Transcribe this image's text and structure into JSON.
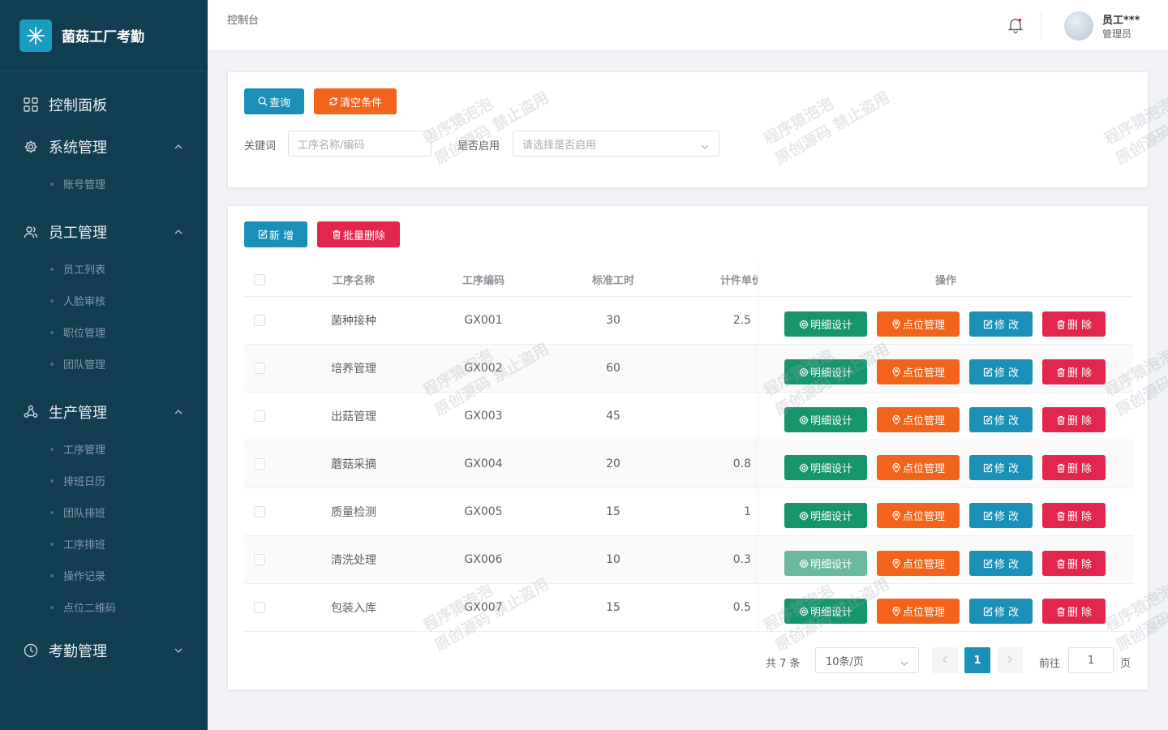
{
  "app": {
    "title": "菌菇工厂考勤"
  },
  "sidebar": {
    "groups": [
      {
        "label": "控制面板",
        "icon": "dashboard-icon",
        "items": []
      },
      {
        "label": "系统管理",
        "icon": "gear-icon",
        "items": [
          "账号管理"
        ]
      },
      {
        "label": "员工管理",
        "icon": "users-icon",
        "items": [
          "员工列表",
          "人脸审核",
          "职位管理",
          "团队管理"
        ]
      },
      {
        "label": "生产管理",
        "icon": "flow-icon",
        "items": [
          "工序管理",
          "排班日历",
          "团队排班",
          "工序排班",
          "操作记录",
          "点位二维码"
        ]
      },
      {
        "label": "考勤管理",
        "icon": "clock-icon",
        "items": []
      }
    ]
  },
  "header": {
    "breadcrumb": "控制台",
    "user_name": "员工***",
    "user_role": "管理员"
  },
  "search": {
    "query_label": "查询",
    "clear_label": "清空条件",
    "keyword_label": "关键词",
    "keyword_placeholder": "工序名称/编码",
    "enabled_label": "是否启用",
    "enabled_placeholder": "请选择是否启用"
  },
  "toolbar": {
    "add_label": "新 增",
    "batch_delete_label": "批量删除"
  },
  "table": {
    "columns": [
      "工序名称",
      "工序编码",
      "标准工时",
      "计件单价",
      "操作"
    ],
    "rows": [
      {
        "name": "菌种接种",
        "code": "GX001",
        "hours": "30",
        "price": "2.5"
      },
      {
        "name": "培养管理",
        "code": "GX002",
        "hours": "60",
        "price": ""
      },
      {
        "name": "出菇管理",
        "code": "GX003",
        "hours": "45",
        "price": ""
      },
      {
        "name": "蘑菇采摘",
        "code": "GX004",
        "hours": "20",
        "price": "0.8"
      },
      {
        "name": "质量检测",
        "code": "GX005",
        "hours": "15",
        "price": "1"
      },
      {
        "name": "清洗处理",
        "code": "GX006",
        "hours": "10",
        "price": "0.3"
      },
      {
        "name": "包装入库",
        "code": "GX007",
        "hours": "15",
        "price": "0.5"
      }
    ],
    "actions": {
      "detail": "明细设计",
      "points": "点位管理",
      "edit": "修 改",
      "delete": "删 除"
    }
  },
  "pagination": {
    "total": "共 7 条",
    "page_size": "10条/页",
    "current_page": "1",
    "goto_label": "前往",
    "goto_value": "1",
    "page_suffix": "页"
  },
  "watermark": {
    "line1": "程序猿泡泡",
    "line2": "原创源码 禁止盗用"
  },
  "colors": {
    "sidebar_bg": "#123e52",
    "primary": "#1a90b6",
    "orange": "#f2631b",
    "red": "#e3264d",
    "green": "#16956d"
  }
}
